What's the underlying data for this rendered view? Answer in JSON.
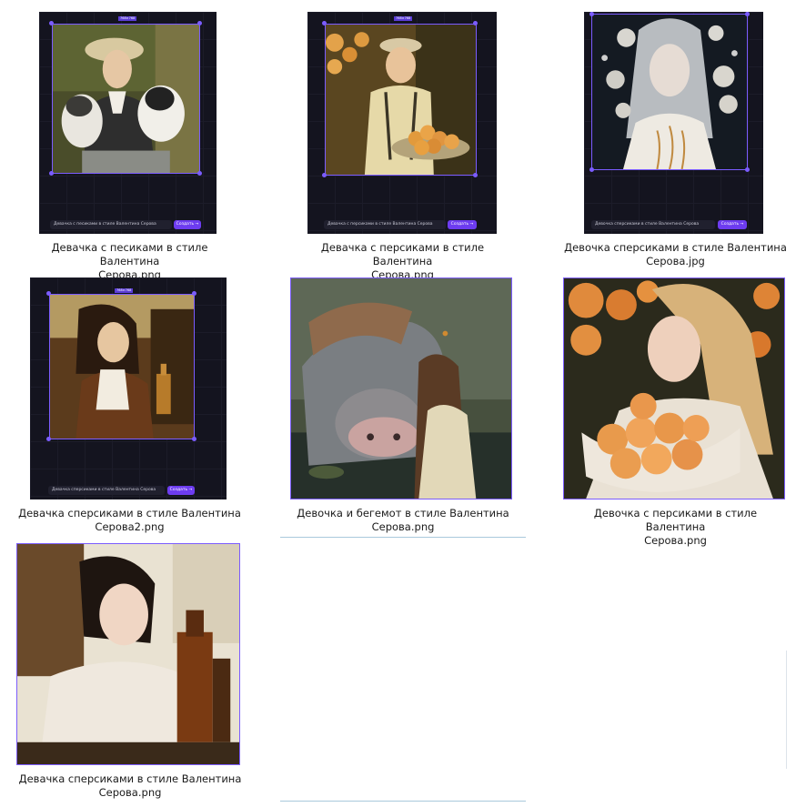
{
  "files": [
    {
      "name_line1": "Девачка с песиками в стиле Валентина",
      "name_line2": "Серова.png",
      "prompt": "Девачка с песиками в стиле Валентина Серова",
      "button": "Создать"
    },
    {
      "name_line1": "Девачка с персиками в стиле Валентина",
      "name_line2": "Серова.png",
      "prompt": "Девачка с персиками в стиле Валентина Серова",
      "button": "Создать"
    },
    {
      "name_line1": "Девочка сперсиками в стиле Валентина",
      "name_line2": "Серова.jpg",
      "prompt": "Девочка сперсиками в стиле Валентина Серова",
      "button": "Создать"
    },
    {
      "name_line1": "Девачка сперсиками в стиле Валентина",
      "name_line2": "Серова2.png",
      "prompt": "Девачка сперсиками в стиле Валентина Серова",
      "button": "Создать"
    },
    {
      "name_line1": "Девочка и бегемот в стиле Валентина",
      "name_line2": "Серова.png"
    },
    {
      "name_line1": "Девочка с персиками в стиле Валентина",
      "name_line2": "Серова.png"
    },
    {
      "name_line1": "Девачка сперсиками в стиле Валентина",
      "name_line2": "Серова.png"
    }
  ],
  "colors": {
    "accent": "#7b5cff",
    "button": "#6d3cf0",
    "app_bg": "#14141f"
  }
}
